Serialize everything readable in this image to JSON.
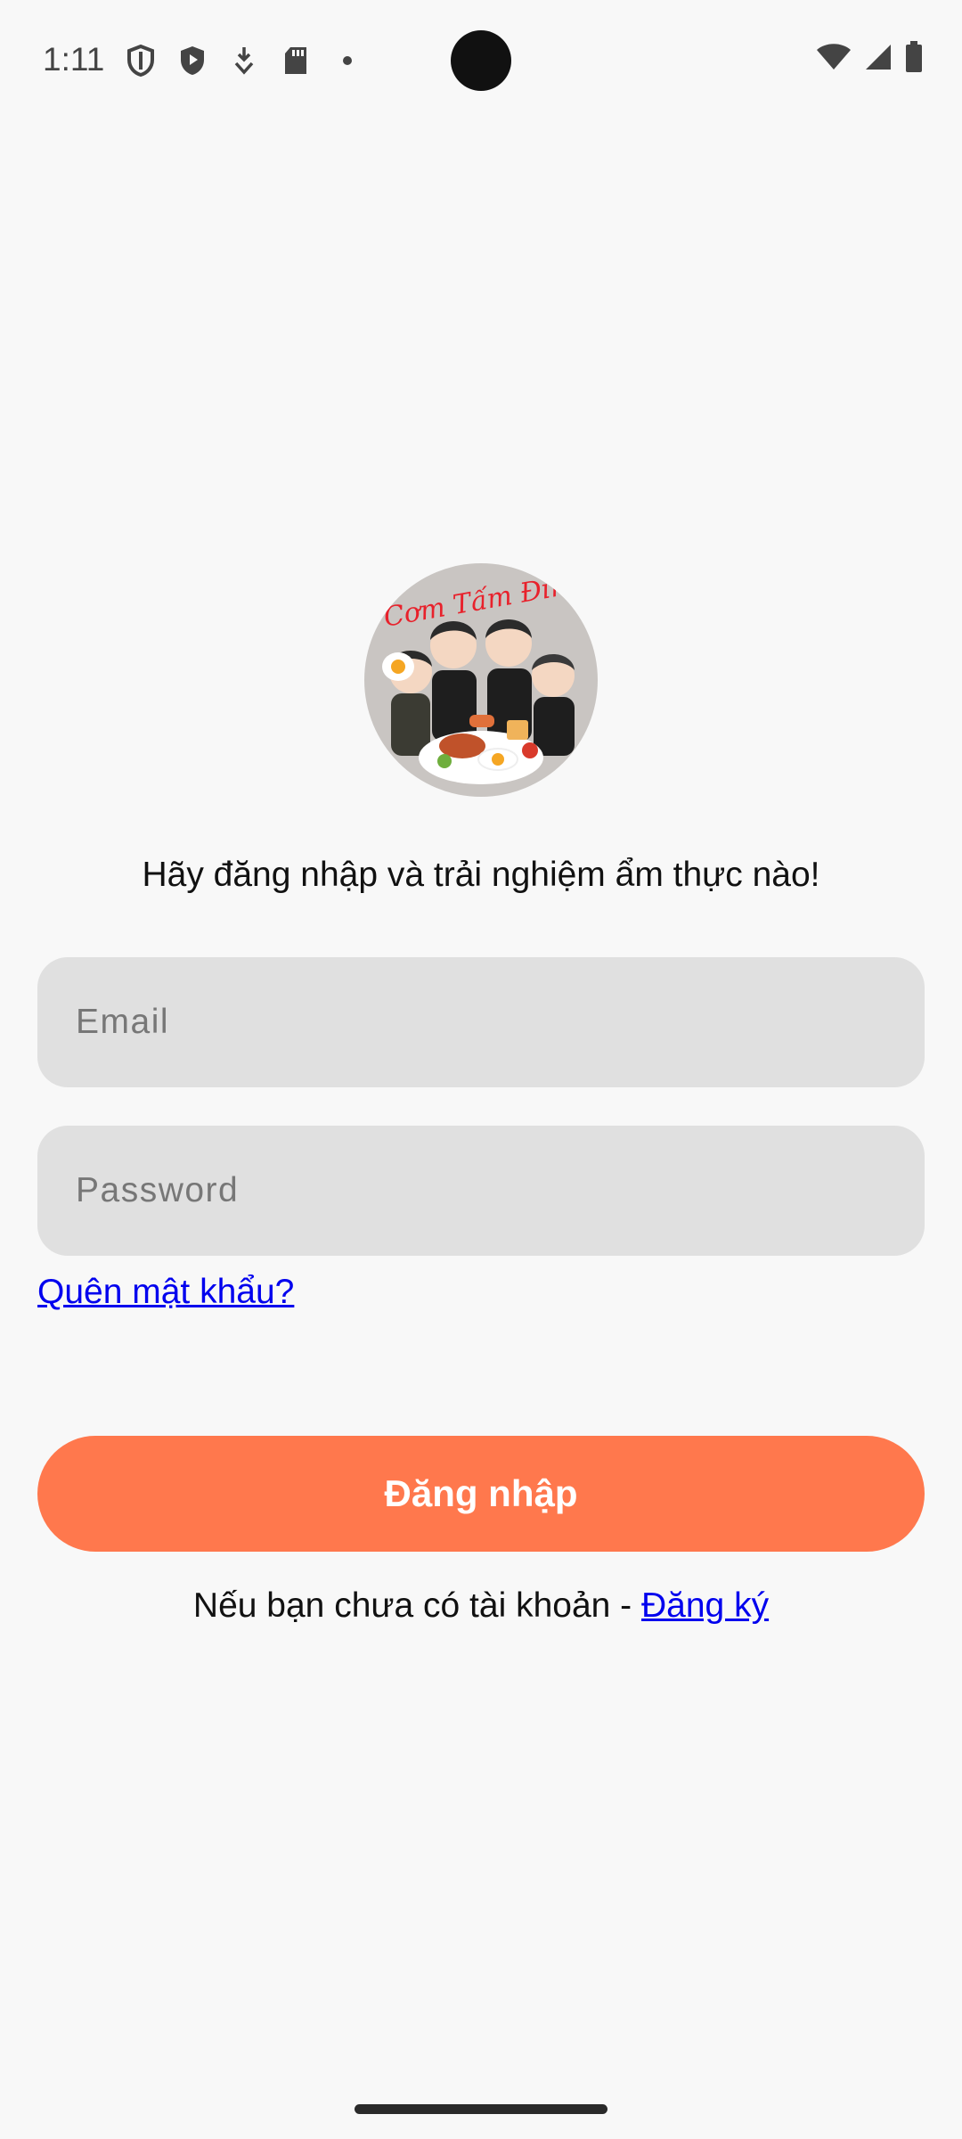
{
  "status_bar": {
    "time": "1:11",
    "left_icons": [
      "shield-outline-icon",
      "shield-play-icon",
      "download-icon",
      "sd-card-icon",
      "dot-icon"
    ],
    "right_icons": [
      "wifi-icon",
      "cellular-signal-icon",
      "battery-icon"
    ]
  },
  "logo": {
    "text": "Cơm Tấm Đim",
    "text_color": "#e8212b",
    "background": "#c9c5c2"
  },
  "tagline": "Hãy đăng nhập và trải nghiệm ẩm thực nào!",
  "form": {
    "email_placeholder": "Email",
    "password_placeholder": "Password",
    "forgot_password": "Quên mật khẩu?"
  },
  "login_button": "Đăng nhập",
  "signup": {
    "prompt": "Nếu bạn chưa có tài khoản - ",
    "link": "Đăng ký"
  },
  "colors": {
    "accent": "#ff784d",
    "link": "#0000ee",
    "field_bg": "#e0e0e0",
    "page_bg": "#f8f8f8"
  }
}
